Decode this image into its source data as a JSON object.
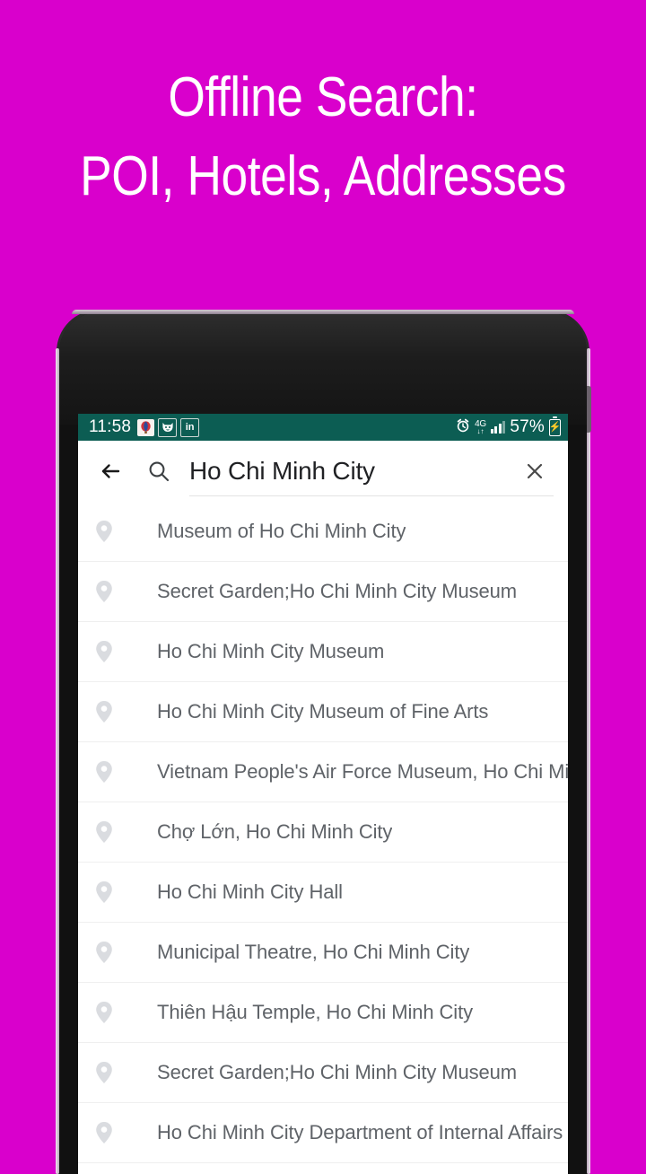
{
  "promo": {
    "headline_line_1": "Offline Search:",
    "headline_line_2": "POI, Hotels, Addresses",
    "background_color": "#d900cc",
    "headline_color": "#ffffff"
  },
  "status_bar": {
    "time": "11:58",
    "battery_percent": "57%",
    "network_type": "4G",
    "background_color": "#0c5d53",
    "notification_icons": [
      {
        "name": "hot-air-balloon-icon",
        "glyph": "🎈"
      },
      {
        "name": "cat-face-icon",
        "glyph": "🐱"
      },
      {
        "name": "linkedin-icon",
        "glyph": "in"
      }
    ],
    "right_icons": [
      {
        "name": "alarm-clock-icon",
        "glyph": "⏰"
      },
      {
        "name": "mobile-data-icon",
        "glyph": "↓↑"
      },
      {
        "name": "signal-bars-icon"
      },
      {
        "name": "battery-charging-icon",
        "glyph": "⚡"
      }
    ]
  },
  "search": {
    "query": "Ho Chi Minh City",
    "placeholder": "Search",
    "back_label": "Back",
    "clear_label": "Clear"
  },
  "results": [
    {
      "label": "Museum of Ho Chi Minh City"
    },
    {
      "label": "Secret Garden;Ho Chi Minh City Museum"
    },
    {
      "label": "Ho Chi Minh City Museum"
    },
    {
      "label": "Ho Chi Minh City Museum of Fine Arts"
    },
    {
      "label": "Vietnam People's Air Force Museum, Ho Chi Min.."
    },
    {
      "label": "Chợ Lớn, Ho Chi Minh City"
    },
    {
      "label": "Ho Chi Minh City Hall"
    },
    {
      "label": "Municipal Theatre, Ho Chi Minh City"
    },
    {
      "label": "Thiên Hậu Temple, Ho Chi Minh City"
    },
    {
      "label": "Secret Garden;Ho Chi Minh City Museum"
    },
    {
      "label": "Ho Chi Minh City Department of Internal Affairs"
    }
  ]
}
